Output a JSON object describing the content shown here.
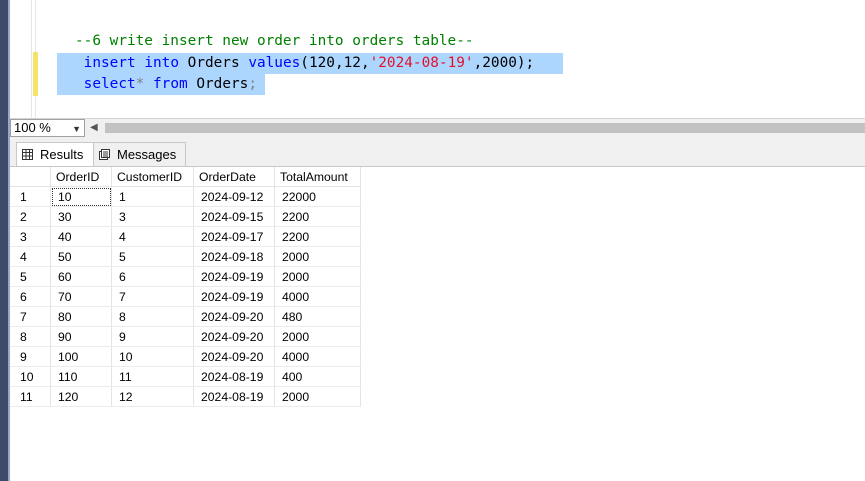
{
  "editor": {
    "comment_line": "--6 write insert new order into orders table--",
    "line2": {
      "insert": "insert",
      "into": "into",
      "table": "Orders",
      "values": "values",
      "open": "(120,12,",
      "date": "'2024-08-19'",
      "close": ",2000);"
    },
    "line3": {
      "select": "select",
      "star": "*",
      "from": "from",
      "table": "Orders",
      "semi": ";"
    }
  },
  "zoom": {
    "value": "100 %"
  },
  "results": {
    "tabs": [
      {
        "label": "Results"
      },
      {
        "label": "Messages"
      }
    ],
    "columns": [
      "OrderID",
      "CustomerID",
      "OrderDate",
      "TotalAmount"
    ],
    "rows": [
      [
        "1",
        "10",
        "1",
        "2024-09-12",
        "22000"
      ],
      [
        "2",
        "30",
        "3",
        "2024-09-15",
        "2200"
      ],
      [
        "3",
        "40",
        "4",
        "2024-09-17",
        "2200"
      ],
      [
        "4",
        "50",
        "5",
        "2024-09-18",
        "2000"
      ],
      [
        "5",
        "60",
        "6",
        "2024-09-19",
        "2000"
      ],
      [
        "6",
        "70",
        "7",
        "2024-09-19",
        "4000"
      ],
      [
        "7",
        "80",
        "8",
        "2024-09-20",
        "480"
      ],
      [
        "8",
        "90",
        "9",
        "2024-09-20",
        "2000"
      ],
      [
        "9",
        "100",
        "10",
        "2024-09-20",
        "4000"
      ],
      [
        "10",
        "110",
        "11",
        "2024-08-19",
        "400"
      ],
      [
        "11",
        "120",
        "12",
        "2024-08-19",
        "2000"
      ]
    ]
  },
  "colors": {
    "keyword": "#0000ff",
    "comment": "#008000",
    "string": "#e0112c",
    "selection": "#add6ff"
  }
}
